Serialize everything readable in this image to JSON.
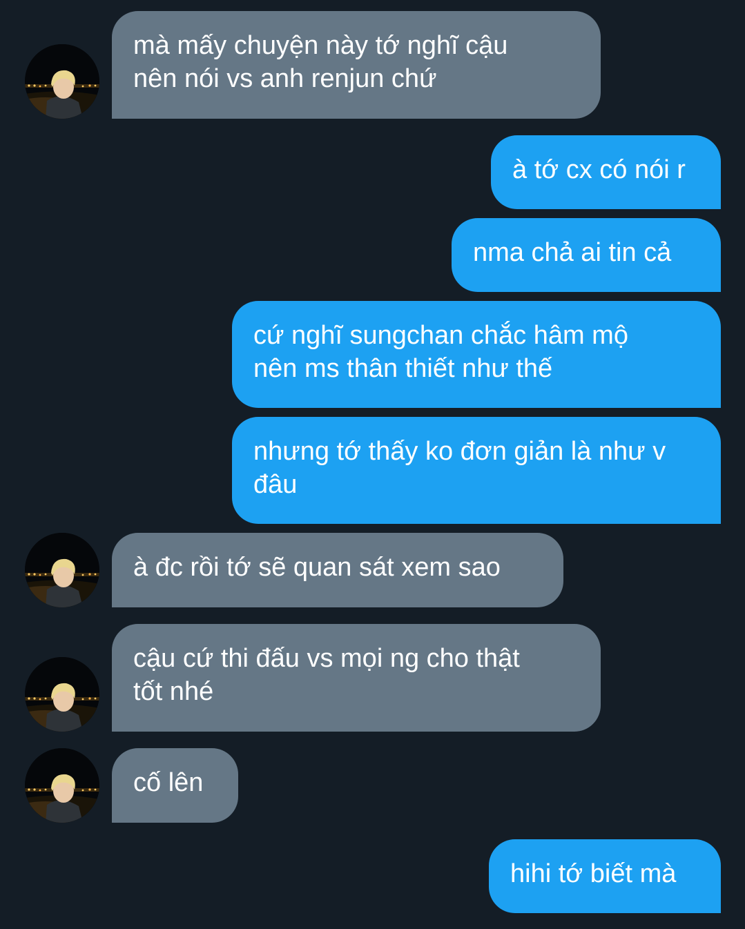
{
  "conversation": {
    "messages": [
      {
        "sender": "them",
        "text": "mà mấy chuyện này tớ nghĩ cậu\nnên nói vs anh renjun chứ",
        "avatar": true
      },
      {
        "sender": "me",
        "text": "à tớ cx có nói r"
      },
      {
        "sender": "me",
        "text": "nma chả ai tin cả"
      },
      {
        "sender": "me",
        "text": "cứ nghĩ sungchan chắc hâm mộ\nnên ms thân thiết như thế"
      },
      {
        "sender": "me",
        "text": "nhưng tớ thấy ko đơn giản là như v\nđâu"
      },
      {
        "sender": "them",
        "text": "à đc rồi tớ sẽ quan sát xem sao",
        "avatar": true
      },
      {
        "sender": "them",
        "text": "cậu cứ thi đấu vs mọi ng cho thật\ntốt nhé",
        "avatar": true
      },
      {
        "sender": "them",
        "text": "cố lên",
        "avatar": true
      },
      {
        "sender": "me",
        "text": "hihi tớ biết mà"
      }
    ]
  },
  "colors": {
    "background": "#141d26",
    "received_bubble": "#657786",
    "sent_bubble": "#1da1f2",
    "text": "#ffffff"
  },
  "icons": {
    "avatar": "contact-avatar-photo"
  }
}
